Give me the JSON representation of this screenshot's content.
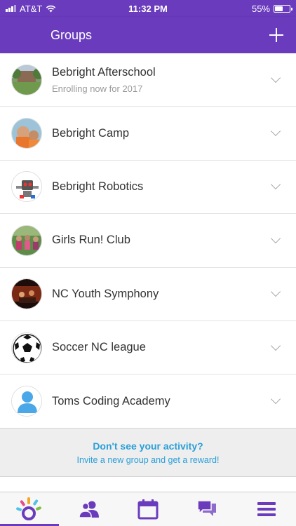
{
  "status": {
    "carrier": "AT&T",
    "time": "11:32 PM",
    "battery": "55%",
    "battery_level": 0.55
  },
  "nav": {
    "title": "Groups"
  },
  "groups": [
    {
      "name": "Bebright Afterschool",
      "subtitle": "Enrolling now for 2017",
      "icon": "afterschool-photo-icon"
    },
    {
      "name": "Bebright Camp",
      "subtitle": "",
      "icon": "camp-photo-icon"
    },
    {
      "name": "Bebright Robotics",
      "subtitle": "",
      "icon": "robot-icon"
    },
    {
      "name": "Girls Run! Club",
      "subtitle": "",
      "icon": "run-club-photo-icon"
    },
    {
      "name": "NC Youth Symphony",
      "subtitle": "",
      "icon": "symphony-photo-icon"
    },
    {
      "name": "Soccer NC league",
      "subtitle": "",
      "icon": "soccer-ball-icon"
    },
    {
      "name": "Toms Coding Academy",
      "subtitle": "",
      "icon": "person-placeholder-icon"
    }
  ],
  "invite": {
    "title": "Don't see your activity?",
    "subtitle": "Invite a new group and get a reward!"
  },
  "tabs": [
    {
      "icon": "home-logo-icon",
      "active": true
    },
    {
      "icon": "people-icon",
      "active": false
    },
    {
      "icon": "calendar-icon",
      "active": false
    },
    {
      "icon": "chat-icon",
      "active": false
    },
    {
      "icon": "menu-icon",
      "active": false
    }
  ],
  "colors": {
    "brand": "#6a3cbd",
    "link": "#2a9fd8"
  }
}
